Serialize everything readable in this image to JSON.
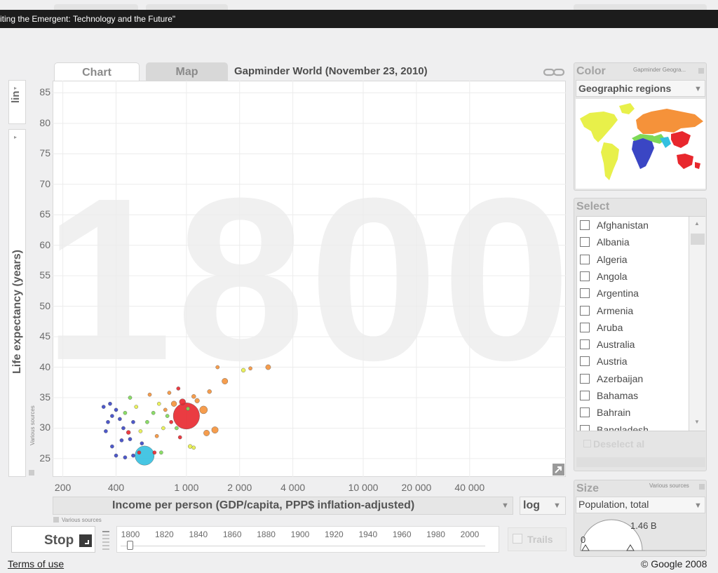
{
  "browser": {
    "title": "iting the Emergent: Technology and the Future\""
  },
  "tabs": [
    {
      "label": "Chart"
    },
    {
      "label": "Map"
    }
  ],
  "header": {
    "title": "Gapminder World (November 23, 2010)"
  },
  "y_axis": {
    "scale_label": "lin",
    "label": "Life expectancy (years)",
    "sources": "Various sources"
  },
  "x_axis": {
    "label": "Income per person (GDP/capita, PPP$ inflation-adjusted)",
    "scale": "log",
    "sources": "Various sources"
  },
  "year": "1800",
  "chart_data": {
    "type": "scatter",
    "xlabel": "Income per person (GDP/capita, PPP$ inflation-adjusted)",
    "ylabel": "Life expectancy (years)",
    "x_scale": "log",
    "xlim": [
      175,
      140000
    ],
    "ylim": [
      22,
      87
    ],
    "x_ticks": [
      {
        "value": 200,
        "label": "200"
      },
      {
        "value": 400,
        "label": "400"
      },
      {
        "value": 1000,
        "label": "1 000"
      },
      {
        "value": 2000,
        "label": "2 000"
      },
      {
        "value": 4000,
        "label": "4 000"
      },
      {
        "value": 10000,
        "label": "10 000"
      },
      {
        "value": 20000,
        "label": "20 000"
      },
      {
        "value": 40000,
        "label": "40 000"
      }
    ],
    "y_ticks": [
      25,
      30,
      35,
      40,
      45,
      50,
      55,
      60,
      65,
      70,
      75,
      80,
      85
    ],
    "grid": true,
    "region_colors": {
      "sub-saharan-africa": "#3a46c4",
      "south-asia": "#33c0e0",
      "middle-east-north-africa": "#7ed957",
      "america": "#e8f04a",
      "europe-central-asia": "#f5923a",
      "east-asia-pacific": "#e8272d"
    },
    "points": [
      {
        "x": 1000,
        "y": 32,
        "pop": 320,
        "region": "east-asia-pacific"
      },
      {
        "x": 580,
        "y": 25.5,
        "pop": 170,
        "region": "south-asia"
      },
      {
        "x": 2900,
        "y": 40,
        "pop": 12,
        "region": "europe-central-asia"
      },
      {
        "x": 2300,
        "y": 39.8,
        "pop": 6,
        "region": "europe-central-asia"
      },
      {
        "x": 2100,
        "y": 39.5,
        "pop": 8,
        "region": "america"
      },
      {
        "x": 1650,
        "y": 37.7,
        "pop": 16,
        "region": "europe-central-asia"
      },
      {
        "x": 1500,
        "y": 40,
        "pop": 5,
        "region": "europe-central-asia"
      },
      {
        "x": 1350,
        "y": 36,
        "pop": 8,
        "region": "europe-central-asia"
      },
      {
        "x": 1250,
        "y": 33,
        "pop": 28,
        "region": "europe-central-asia"
      },
      {
        "x": 1450,
        "y": 29.7,
        "pop": 20,
        "region": "europe-central-asia"
      },
      {
        "x": 1300,
        "y": 29.2,
        "pop": 16,
        "region": "europe-central-asia"
      },
      {
        "x": 1050,
        "y": 27,
        "pop": 8,
        "region": "america"
      },
      {
        "x": 850,
        "y": 34,
        "pop": 14,
        "region": "europe-central-asia"
      },
      {
        "x": 950,
        "y": 34.3,
        "pop": 18,
        "region": "east-asia-pacific"
      },
      {
        "x": 1150,
        "y": 34.5,
        "pop": 10,
        "region": "europe-central-asia"
      },
      {
        "x": 1100,
        "y": 35.2,
        "pop": 8,
        "region": "europe-central-asia"
      },
      {
        "x": 900,
        "y": 36.5,
        "pop": 4,
        "region": "east-asia-pacific"
      },
      {
        "x": 800,
        "y": 35.8,
        "pop": 4,
        "region": "europe-central-asia"
      },
      {
        "x": 700,
        "y": 34,
        "pop": 4,
        "region": "america"
      },
      {
        "x": 760,
        "y": 33,
        "pop": 5,
        "region": "europe-central-asia"
      },
      {
        "x": 650,
        "y": 32.5,
        "pop": 5,
        "region": "middle-east-north-africa"
      },
      {
        "x": 600,
        "y": 31,
        "pop": 4,
        "region": "middle-east-north-africa"
      },
      {
        "x": 550,
        "y": 29.5,
        "pop": 5,
        "region": "america"
      },
      {
        "x": 520,
        "y": 33.5,
        "pop": 5,
        "region": "america"
      },
      {
        "x": 480,
        "y": 35,
        "pop": 3,
        "region": "middle-east-north-africa"
      },
      {
        "x": 620,
        "y": 35.5,
        "pop": 3,
        "region": "europe-central-asia"
      },
      {
        "x": 720,
        "y": 26,
        "pop": 6,
        "region": "middle-east-north-africa"
      },
      {
        "x": 660,
        "y": 26,
        "pop": 4,
        "region": "east-asia-pacific"
      },
      {
        "x": 540,
        "y": 26,
        "pop": 4,
        "region": "east-asia-pacific"
      },
      {
        "x": 500,
        "y": 25.5,
        "pop": 3,
        "region": "sub-saharan-africa"
      },
      {
        "x": 450,
        "y": 25.2,
        "pop": 3,
        "region": "sub-saharan-africa"
      },
      {
        "x": 400,
        "y": 25.5,
        "pop": 3,
        "region": "sub-saharan-africa"
      },
      {
        "x": 380,
        "y": 27,
        "pop": 3,
        "region": "sub-saharan-africa"
      },
      {
        "x": 350,
        "y": 29.5,
        "pop": 3,
        "region": "sub-saharan-africa"
      },
      {
        "x": 360,
        "y": 31,
        "pop": 4,
        "region": "sub-saharan-africa"
      },
      {
        "x": 380,
        "y": 32,
        "pop": 4,
        "region": "sub-saharan-africa"
      },
      {
        "x": 400,
        "y": 33,
        "pop": 3,
        "region": "sub-saharan-africa"
      },
      {
        "x": 420,
        "y": 31.5,
        "pop": 6,
        "region": "sub-saharan-africa"
      },
      {
        "x": 440,
        "y": 30,
        "pop": 5,
        "region": "sub-saharan-africa"
      },
      {
        "x": 470,
        "y": 29.3,
        "pop": 8,
        "region": "east-asia-pacific"
      },
      {
        "x": 500,
        "y": 31,
        "pop": 4,
        "region": "sub-saharan-africa"
      },
      {
        "x": 450,
        "y": 32.5,
        "pop": 4,
        "region": "middle-east-north-africa"
      },
      {
        "x": 340,
        "y": 33.5,
        "pop": 3,
        "region": "sub-saharan-africa"
      },
      {
        "x": 370,
        "y": 34,
        "pop": 3,
        "region": "sub-saharan-africa"
      },
      {
        "x": 430,
        "y": 28,
        "pop": 4,
        "region": "sub-saharan-africa"
      },
      {
        "x": 480,
        "y": 28.2,
        "pop": 3,
        "region": "sub-saharan-africa"
      },
      {
        "x": 560,
        "y": 27.5,
        "pop": 4,
        "region": "sub-saharan-africa"
      },
      {
        "x": 820,
        "y": 31,
        "pop": 4,
        "region": "east-asia-pacific"
      },
      {
        "x": 880,
        "y": 30,
        "pop": 4,
        "region": "middle-east-north-africa"
      },
      {
        "x": 920,
        "y": 28.5,
        "pop": 5,
        "region": "east-asia-pacific"
      },
      {
        "x": 1100,
        "y": 26.8,
        "pop": 6,
        "region": "america"
      },
      {
        "x": 740,
        "y": 30,
        "pop": 4,
        "region": "america"
      },
      {
        "x": 680,
        "y": 28.7,
        "pop": 4,
        "region": "europe-central-asia"
      },
      {
        "x": 1020,
        "y": 33.2,
        "pop": 4,
        "region": "middle-east-north-africa"
      },
      {
        "x": 780,
        "y": 32,
        "pop": 4,
        "region": "middle-east-north-africa"
      }
    ]
  },
  "color_panel": {
    "title": "Color",
    "source": "Gapminder Geogra...",
    "selected": "Geographic regions"
  },
  "select_panel": {
    "title": "Select",
    "countries": [
      "Afghanistan",
      "Albania",
      "Algeria",
      "Angola",
      "Argentina",
      "Armenia",
      "Aruba",
      "Australia",
      "Austria",
      "Azerbaijan",
      "Bahamas",
      "Bahrain",
      "Bangladesh"
    ],
    "deselect_label": "Deselect al"
  },
  "size_panel": {
    "title": "Size",
    "source": "Various sources",
    "selected": "Population, total",
    "max_label": "1.46 B",
    "min_label": "0"
  },
  "playback": {
    "stop_label": "Stop",
    "trails_label": "Trails",
    "timeline_ticks": [
      "1800",
      "1820",
      "1840",
      "1860",
      "1880",
      "1900",
      "1920",
      "1940",
      "1960",
      "1980",
      "2000"
    ]
  },
  "footer": {
    "terms": "Terms of use",
    "copyright": "© Google 2008"
  }
}
